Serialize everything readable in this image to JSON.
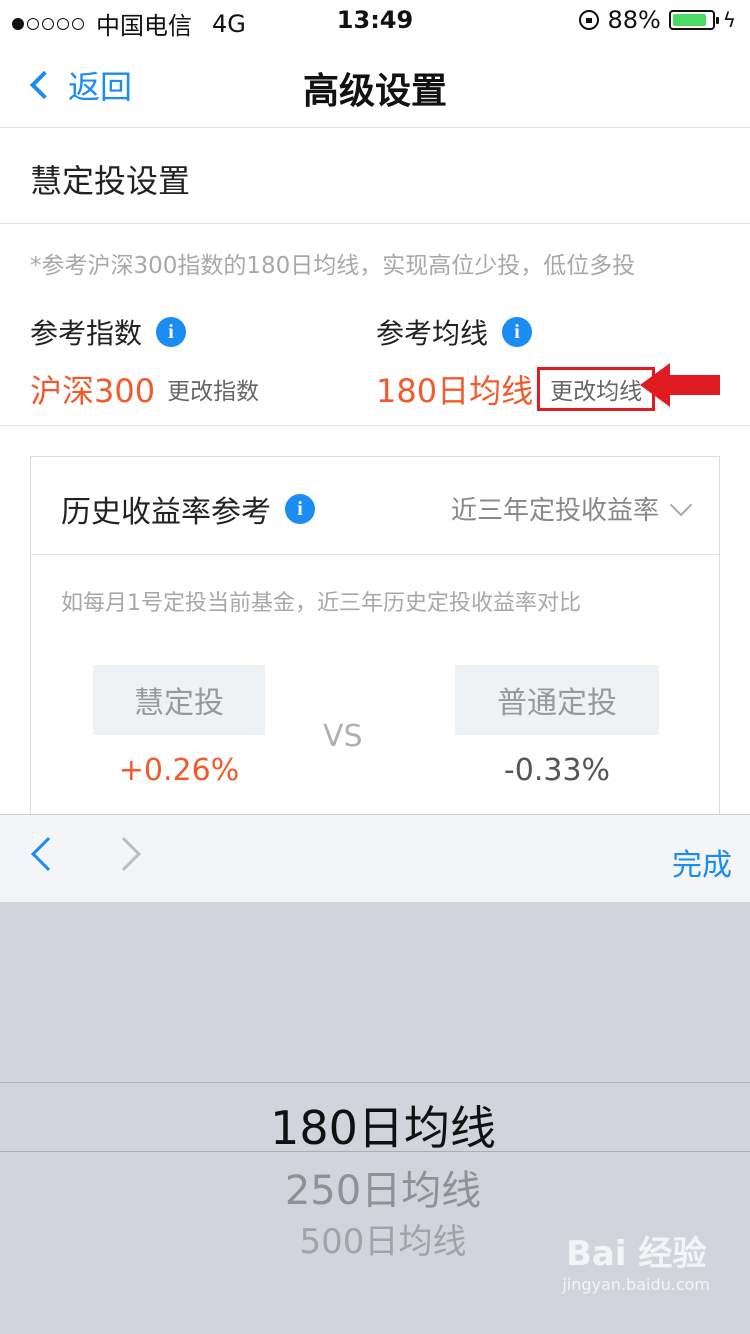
{
  "status_bar": {
    "carrier": "中国电信",
    "network": "4G",
    "time": "13:49",
    "battery": "88%",
    "battery_level": 0.88
  },
  "nav": {
    "back_label": "返回",
    "title": "高级设置"
  },
  "section": {
    "title": "慧定投设置"
  },
  "note": "*参考沪深300指数的180日均线，实现高位少投，低位多投",
  "reference": {
    "index": {
      "label": "参考指数",
      "value": "沪深300",
      "change_label": "更改指数"
    },
    "ma": {
      "label": "参考均线",
      "value": "180日均线",
      "change_label": "更改均线"
    }
  },
  "history": {
    "title": "历史收益率参考",
    "selector": "近三年定投收益率",
    "description": "如每月1号定投当前基金，近三年历史定投收益率对比",
    "left": {
      "label": "慧定投",
      "value": "+0.26%"
    },
    "vs": "VS",
    "right": {
      "label": "普通定投",
      "value": "-0.33%"
    }
  },
  "toolbar": {
    "done_label": "完成"
  },
  "picker": {
    "options": [
      "180日均线",
      "250日均线",
      "500日均线"
    ],
    "selected_index": 0
  },
  "watermark": {
    "main": "Bai 经验",
    "sub": "jingyan.baidu.com"
  },
  "colors": {
    "accent": "#1a8cf2",
    "value": "#f25a2a",
    "highlight": "#e11b22"
  }
}
